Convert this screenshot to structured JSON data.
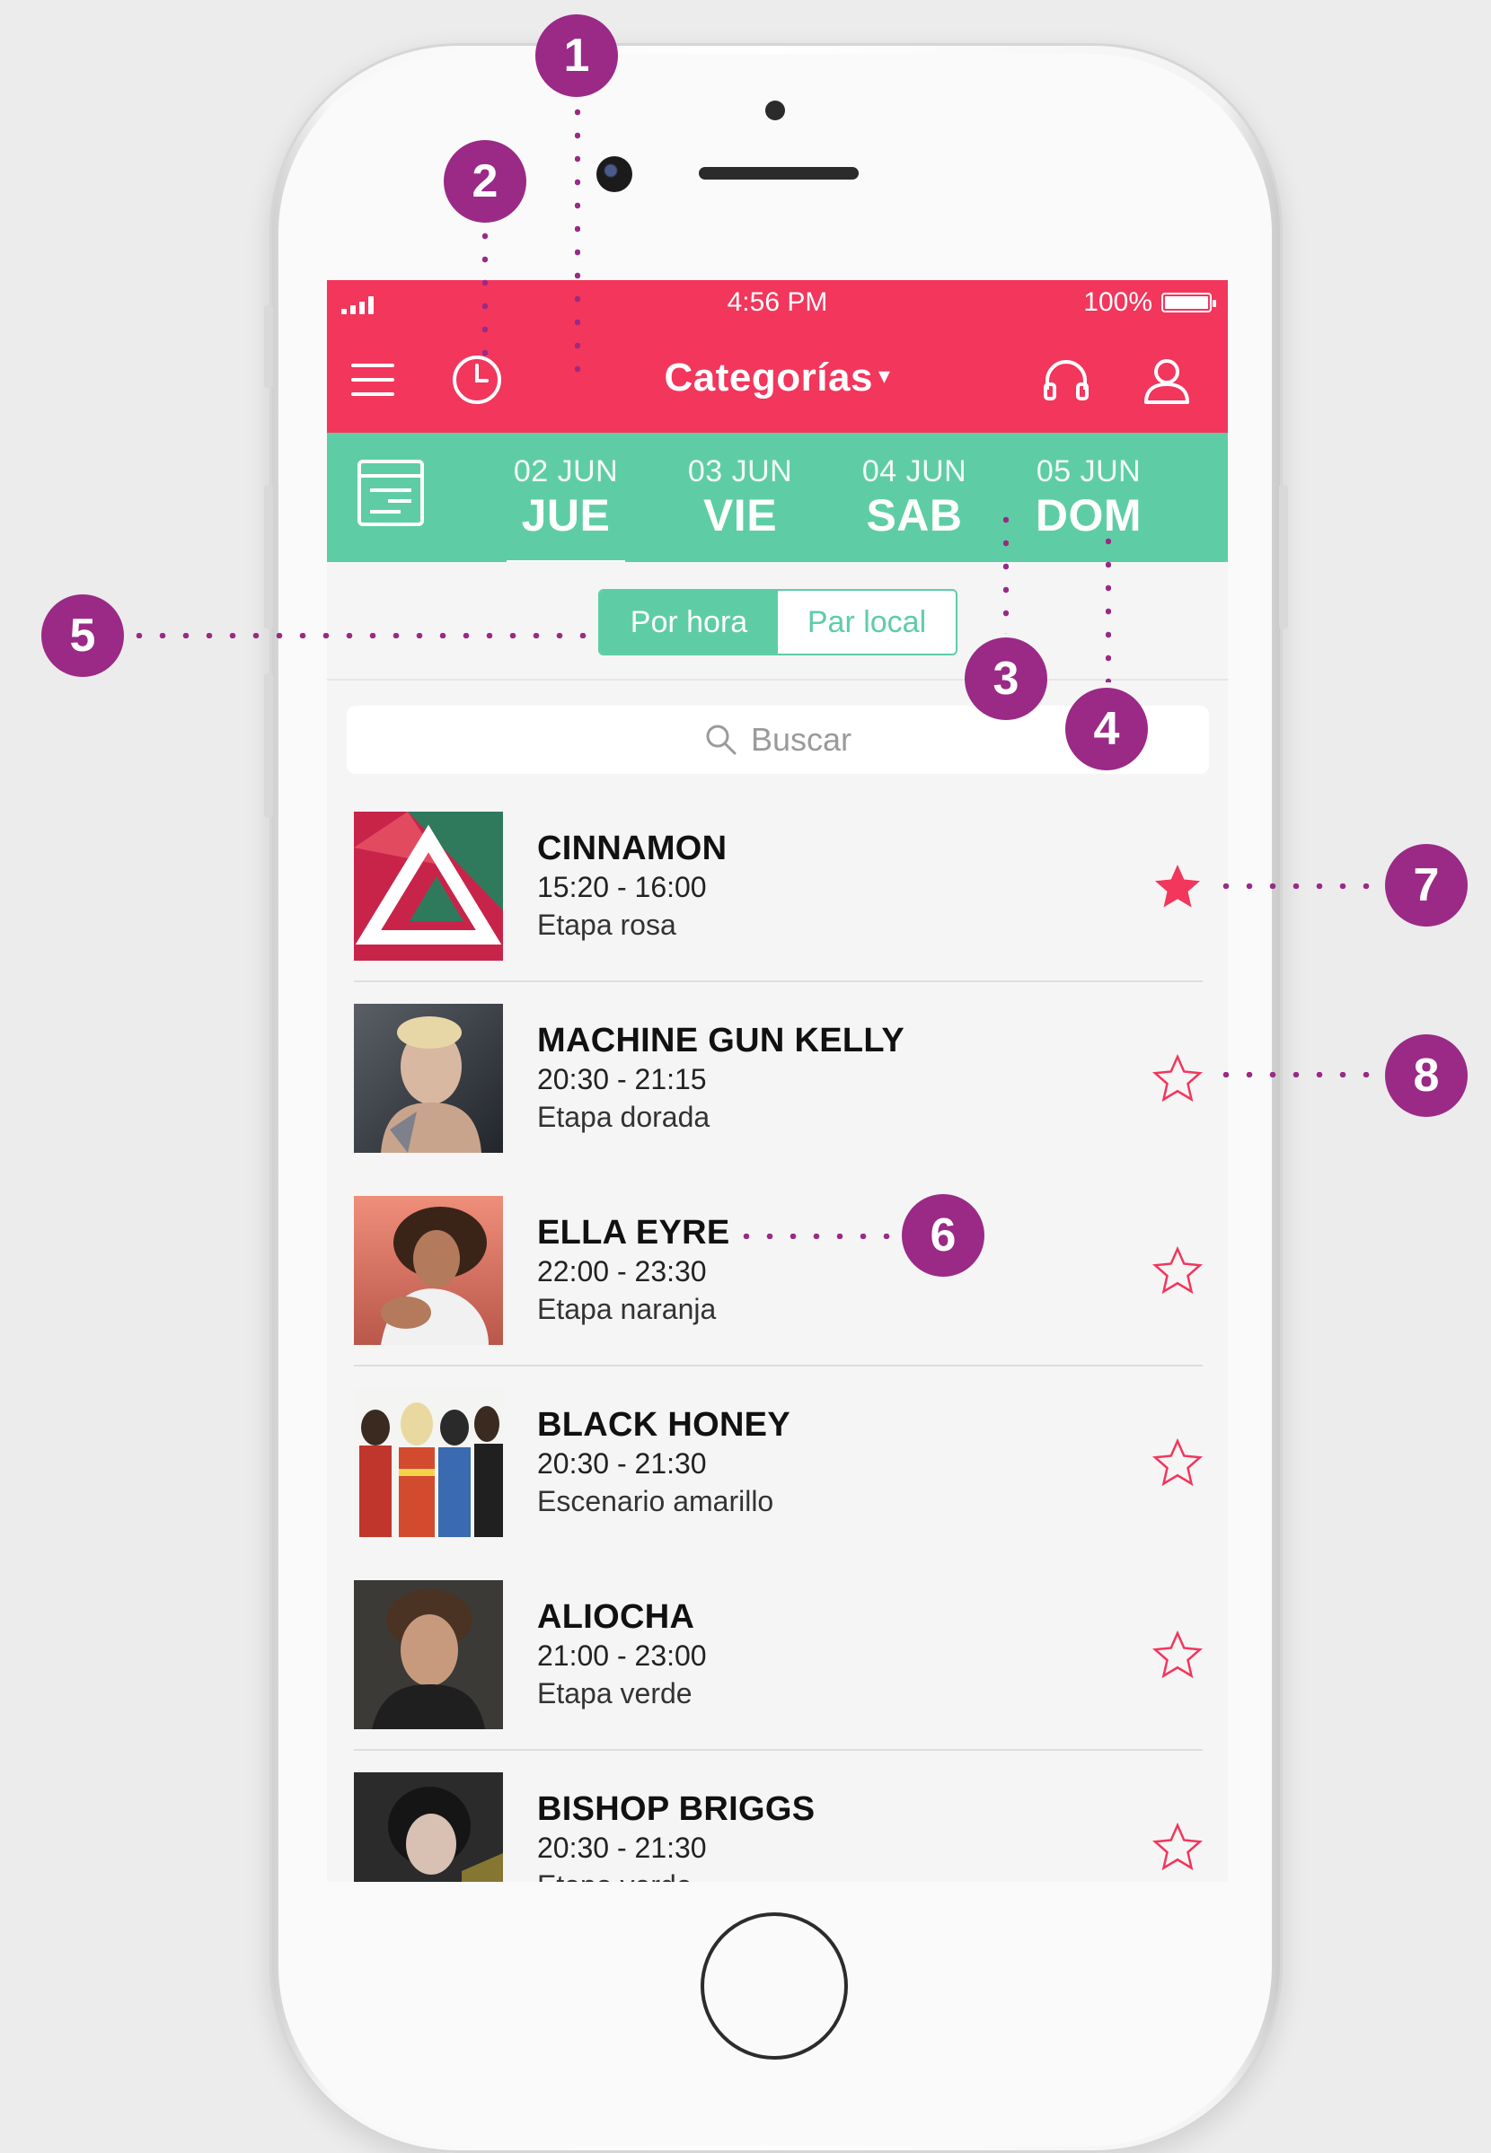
{
  "colors": {
    "nav": "#f2365c",
    "accent": "#5ecda5",
    "star": "#f2365c",
    "annotation": "#9a2a86"
  },
  "status": {
    "time": "4:56 PM",
    "battery": "100%"
  },
  "nav": {
    "title": "Categorías",
    "caret": "▾",
    "icons": [
      "menu-icon",
      "clock-icon",
      "headphones-icon",
      "user-icon"
    ]
  },
  "days": [
    {
      "date": "02 JUN",
      "name": "JUE",
      "active": true
    },
    {
      "date": "03 JUN",
      "name": "VIE",
      "active": false
    },
    {
      "date": "04 JUN",
      "name": "SAB",
      "active": false
    },
    {
      "date": "05 JUN",
      "name": "DOM",
      "active": false
    }
  ],
  "segment": {
    "by_hour": "Por hora",
    "by_place": "Par local",
    "selected": "Por hora"
  },
  "search": {
    "placeholder": "Buscar"
  },
  "artists": [
    {
      "name": "CINNAMON",
      "time": "15:20 - 16:00",
      "stage": "Etapa rosa",
      "favorite": true
    },
    {
      "name": "MACHINE GUN KELLY",
      "time": "20:30 - 21:15",
      "stage": "Etapa dorada",
      "favorite": false
    },
    {
      "name": "ELLA EYRE",
      "time": "22:00 - 23:30",
      "stage": "Etapa naranja",
      "favorite": false
    },
    {
      "name": "BLACK HONEY",
      "time": "20:30 - 21:30",
      "stage": "Escenario amarillo",
      "favorite": false
    },
    {
      "name": "ALIOCHA",
      "time": "21:00 - 23:00",
      "stage": "Etapa verde",
      "favorite": false
    },
    {
      "name": "BISHOP BRIGGS",
      "time": "20:30 - 21:30",
      "stage": "Etapa verde",
      "favorite": false
    }
  ],
  "callouts": [
    "1",
    "2",
    "3",
    "4",
    "5",
    "6",
    "7",
    "8"
  ]
}
